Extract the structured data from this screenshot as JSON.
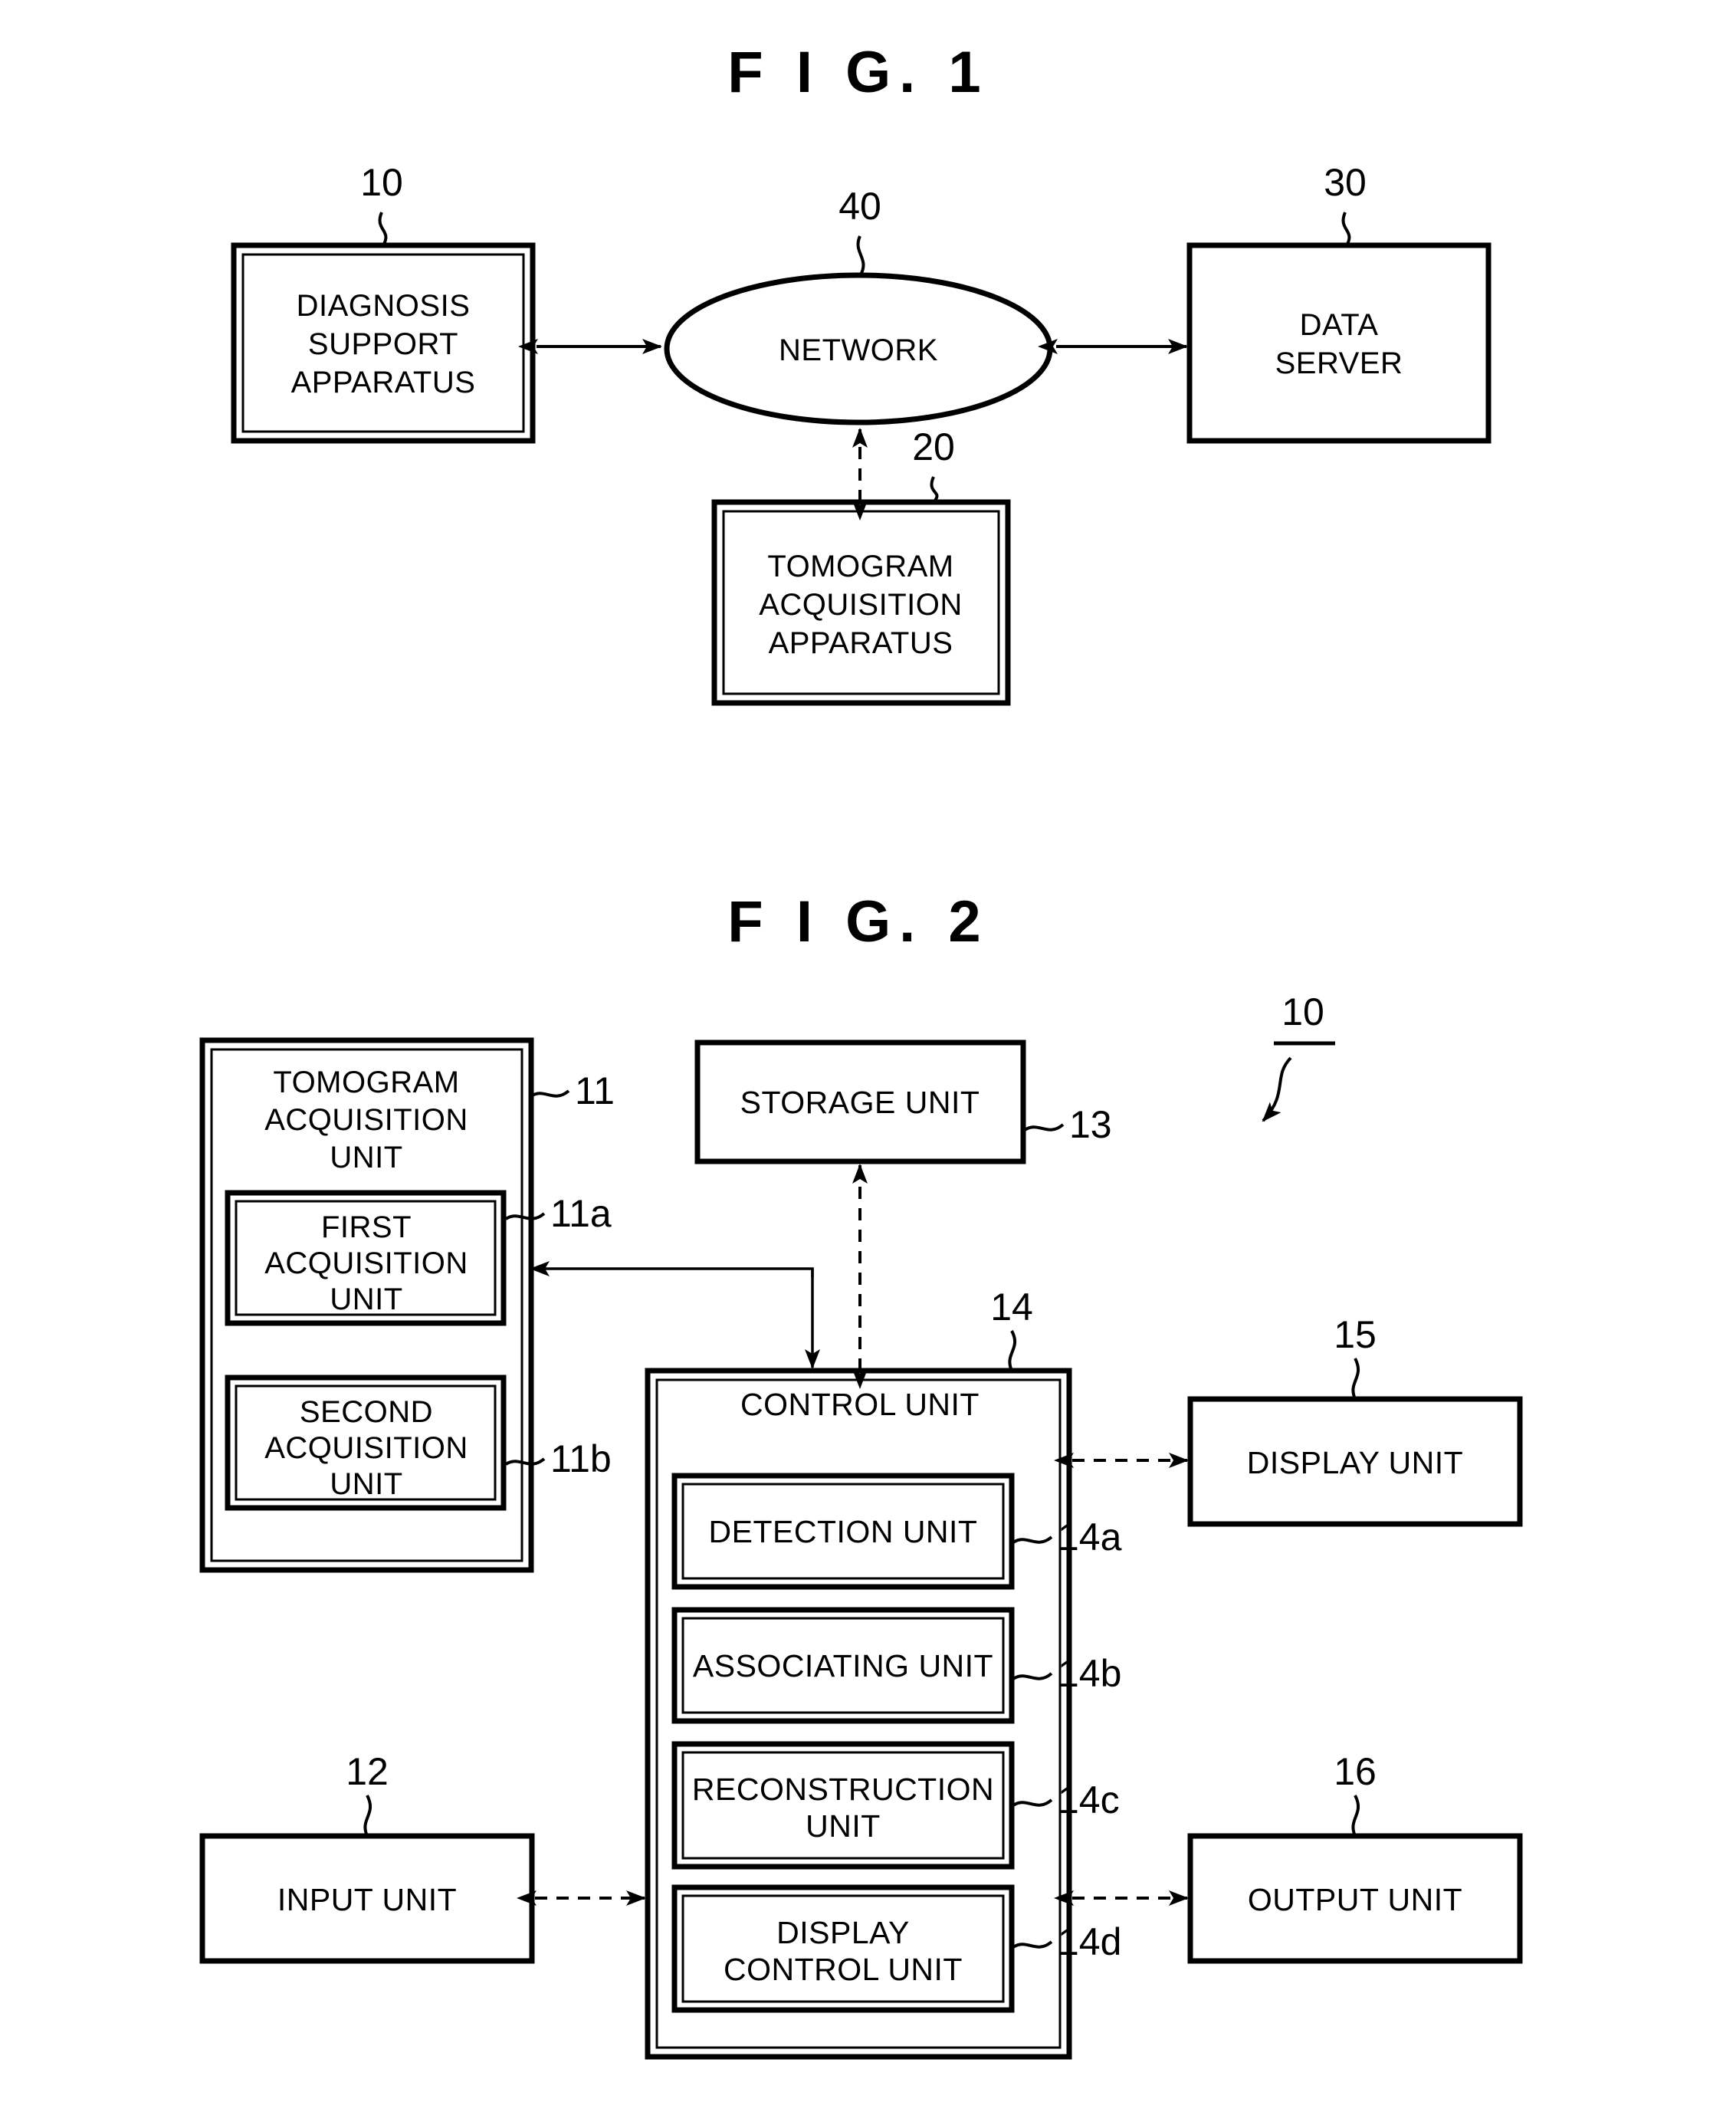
{
  "figures": [
    {
      "id": "fig1",
      "title": "F I G. 1",
      "nodes": [
        {
          "key": "diagnosis_support_apparatus",
          "ref": "10",
          "lines": [
            "DIAGNOSIS",
            "SUPPORT",
            "APPARATUS"
          ]
        },
        {
          "key": "network",
          "ref": "40",
          "lines": [
            "NETWORK"
          ]
        },
        {
          "key": "data_server",
          "ref": "30",
          "lines": [
            "DATA",
            "SERVER"
          ]
        },
        {
          "key": "tomogram_acquisition_apparatus",
          "ref": "20",
          "lines": [
            "TOMOGRAM",
            "ACQUISITION",
            "APPARATUS"
          ]
        }
      ]
    },
    {
      "id": "fig2",
      "title": "F I G. 2",
      "system_ref": "10",
      "nodes": [
        {
          "key": "tomogram_acquisition_unit",
          "ref": "11",
          "lines": [
            "TOMOGRAM",
            "ACQUISITION",
            "UNIT"
          ]
        },
        {
          "key": "first_acquisition_unit",
          "ref": "11a",
          "lines": [
            "FIRST",
            "ACQUISITION",
            "UNIT"
          ]
        },
        {
          "key": "second_acquisition_unit",
          "ref": "11b",
          "lines": [
            "SECOND",
            "ACQUISITION",
            "UNIT"
          ]
        },
        {
          "key": "storage_unit",
          "ref": "13",
          "lines": [
            "STORAGE UNIT"
          ]
        },
        {
          "key": "control_unit",
          "ref": "14",
          "lines": [
            "CONTROL UNIT"
          ]
        },
        {
          "key": "detection_unit",
          "ref": "14a",
          "lines": [
            "DETECTION UNIT"
          ]
        },
        {
          "key": "associating_unit",
          "ref": "14b",
          "lines": [
            "ASSOCIATING UNIT"
          ]
        },
        {
          "key": "reconstruction_unit",
          "ref": "14c",
          "lines": [
            "RECONSTRUCTION",
            "UNIT"
          ]
        },
        {
          "key": "display_control_unit",
          "ref": "14d",
          "lines": [
            "DISPLAY",
            "CONTROL UNIT"
          ]
        },
        {
          "key": "display_unit",
          "ref": "15",
          "lines": [
            "DISPLAY UNIT"
          ]
        },
        {
          "key": "input_unit",
          "ref": "12",
          "lines": [
            "INPUT UNIT"
          ]
        },
        {
          "key": "output_unit",
          "ref": "16",
          "lines": [
            "OUTPUT UNIT"
          ]
        }
      ]
    }
  ],
  "fig1": {
    "title": "F I G. 1",
    "diagnosis_support_apparatus": {
      "ref": "10",
      "line1": "DIAGNOSIS",
      "line2": "SUPPORT",
      "line3": "APPARATUS"
    },
    "network": {
      "ref": "40",
      "label": "NETWORK"
    },
    "data_server": {
      "ref": "30",
      "line1": "DATA",
      "line2": "SERVER"
    },
    "tomogram_acquisition_apparatus": {
      "ref": "20",
      "line1": "TOMOGRAM",
      "line2": "ACQUISITION",
      "line3": "APPARATUS"
    }
  },
  "fig2": {
    "title": "F I G. 2",
    "system_ref": "10",
    "tomogram_acquisition_unit": {
      "ref": "11",
      "line1": "TOMOGRAM",
      "line2": "ACQUISITION",
      "line3": "UNIT"
    },
    "first_acquisition_unit": {
      "ref": "11a",
      "line1": "FIRST",
      "line2": "ACQUISITION",
      "line3": "UNIT"
    },
    "second_acquisition_unit": {
      "ref": "11b",
      "line1": "SECOND",
      "line2": "ACQUISITION",
      "line3": "UNIT"
    },
    "storage_unit": {
      "ref": "13",
      "label": "STORAGE UNIT"
    },
    "control_unit": {
      "ref": "14",
      "label": "CONTROL UNIT"
    },
    "detection_unit": {
      "ref": "14a",
      "label": "DETECTION UNIT"
    },
    "associating_unit": {
      "ref": "14b",
      "label": "ASSOCIATING UNIT"
    },
    "reconstruction_unit": {
      "ref": "14c",
      "line1": "RECONSTRUCTION",
      "line2": "UNIT"
    },
    "display_control_unit": {
      "ref": "14d",
      "line1": "DISPLAY",
      "line2": "CONTROL UNIT"
    },
    "display_unit": {
      "ref": "15",
      "label": "DISPLAY UNIT"
    },
    "input_unit": {
      "ref": "12",
      "label": "INPUT UNIT"
    },
    "output_unit": {
      "ref": "16",
      "label": "OUTPUT UNIT"
    }
  }
}
